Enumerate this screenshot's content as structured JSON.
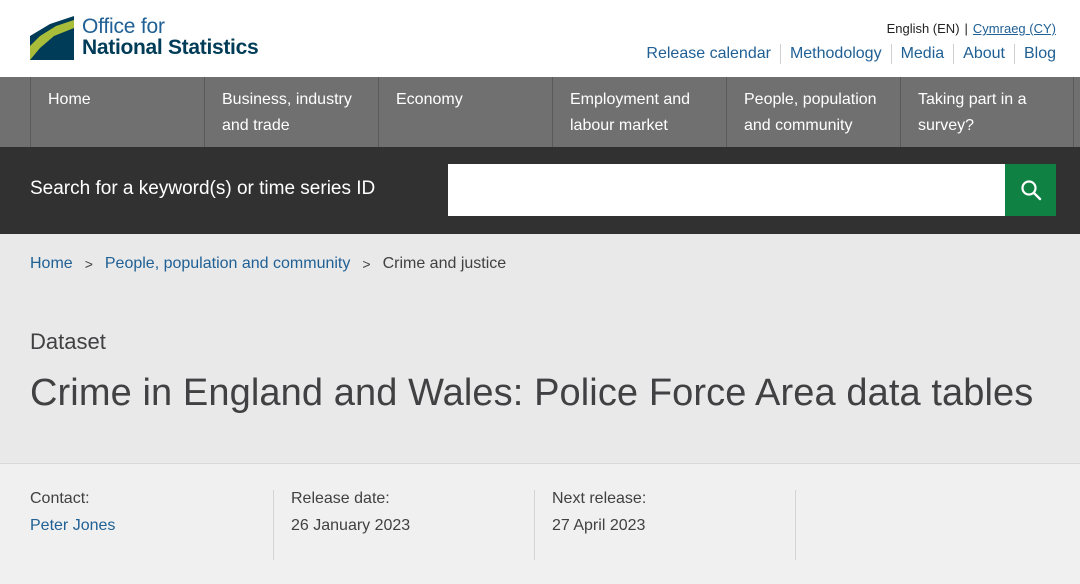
{
  "header": {
    "logo_line1": "Office for",
    "logo_line2": "National Statistics",
    "lang_en": "English (EN)",
    "lang_separator": "|",
    "lang_cy": "Cymraeg (CY)",
    "links": [
      "Release calendar",
      "Methodology",
      "Media",
      "About",
      "Blog"
    ]
  },
  "nav": {
    "items": [
      "Home",
      "Business, industry and trade",
      "Economy",
      "Employment and labour market",
      "People, population and community",
      "Taking part in a survey?"
    ]
  },
  "search": {
    "label": "Search for a keyword(s) or time series ID",
    "value": "",
    "icon": "search-icon"
  },
  "breadcrumb": {
    "items": [
      "Home",
      "People, population and community"
    ],
    "separator": ">",
    "current": "Crime and justice"
  },
  "page": {
    "type_label": "Dataset",
    "title": "Crime in England and Wales: Police Force Area data tables"
  },
  "meta": {
    "contact_label": "Contact:",
    "contact_value": "Peter Jones",
    "release_label": "Release date:",
    "release_value": "26 January 2023",
    "next_label": "Next release:",
    "next_value": "27 April 2023"
  },
  "colors": {
    "brand_blue": "#206095",
    "nav_grey": "#707071",
    "search_bg": "#323132",
    "search_button": "#0f8243"
  }
}
